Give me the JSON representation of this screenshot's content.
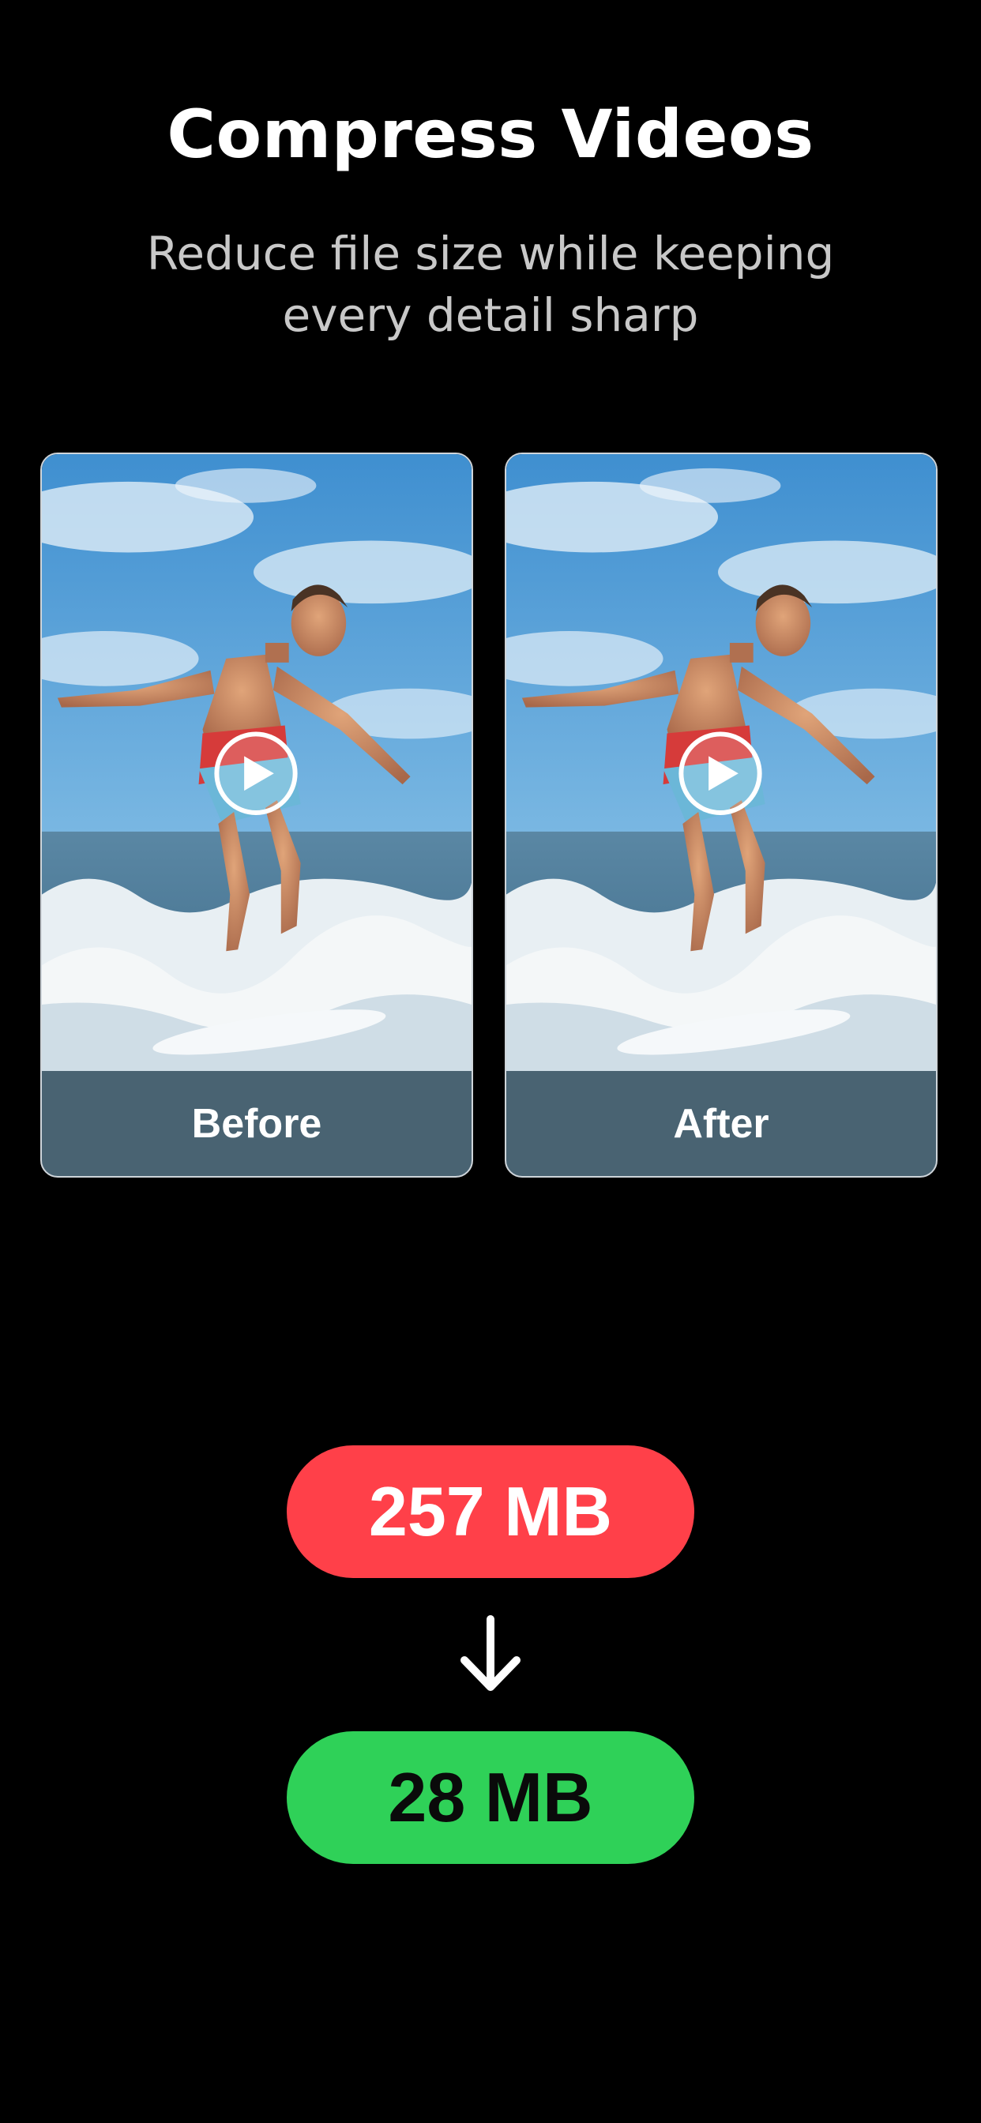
{
  "header": {
    "title": "Compress Videos",
    "subtitle": "Reduce file size while keeping every detail sharp"
  },
  "comparison": {
    "before_label": "Before",
    "after_label": "After"
  },
  "sizes": {
    "original": "257 MB",
    "compressed": "28 MB"
  },
  "colors": {
    "background": "#000000",
    "original_pill": "#ff4049",
    "compressed_pill": "#2fd158"
  },
  "icons": {
    "play": "play-icon",
    "arrow": "arrow-down-icon"
  }
}
